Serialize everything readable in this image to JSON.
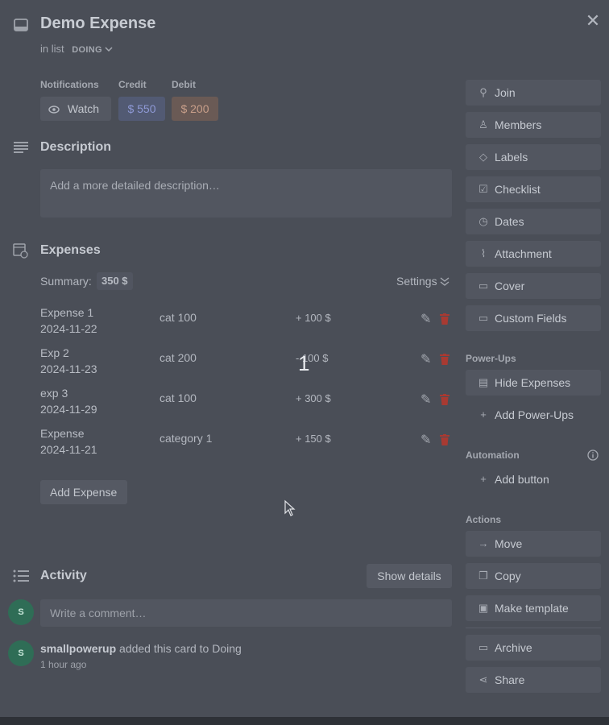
{
  "card": {
    "title": "Demo Expense",
    "in_list_prefix": "in list",
    "list_name": "DOING"
  },
  "labels": {
    "notifications": "Notifications",
    "credit": "Credit",
    "debit": "Debit"
  },
  "watch_label": "Watch",
  "credit_value": "$ 550",
  "debit_value": "$ 200",
  "description": {
    "heading": "Description",
    "placeholder": "Add a more detailed description…"
  },
  "expenses": {
    "heading": "Expenses",
    "summary_label": "Summary:",
    "summary_value": "350 $",
    "settings_label": "Settings",
    "items": [
      {
        "name": "Expense 1",
        "date": "2024-11-22",
        "category": "cat 100",
        "amount": "+ 100 $"
      },
      {
        "name": "Exp 2",
        "date": "2024-11-23",
        "category": "cat 200",
        "amount": "- 100 $"
      },
      {
        "name": "exp 3",
        "date": "2024-11-29",
        "category": "cat 100",
        "amount": "+ 300 $"
      },
      {
        "name": "Expense",
        "date": "2024-11-21",
        "category": "category 1",
        "amount": "+ 150 $"
      }
    ],
    "add_button": "Add Expense"
  },
  "activity": {
    "heading": "Activity",
    "show_details": "Show details",
    "comment_placeholder": "Write a comment…",
    "avatar_initial": "S",
    "entry_user": "smallpowerup",
    "entry_text": "added this card to Doing",
    "entry_time": "1 hour ago"
  },
  "sidebar": {
    "buttons": [
      {
        "label": "Join",
        "icon": "person-add-icon"
      },
      {
        "label": "Members",
        "icon": "person-icon"
      },
      {
        "label": "Labels",
        "icon": "label-icon"
      },
      {
        "label": "Checklist",
        "icon": "checklist-icon"
      },
      {
        "label": "Dates",
        "icon": "clock-icon"
      },
      {
        "label": "Attachment",
        "icon": "paperclip-icon"
      },
      {
        "label": "Cover",
        "icon": "cover-icon"
      },
      {
        "label": "Custom Fields",
        "icon": "custom-fields-icon"
      }
    ],
    "powerups_label": "Power-Ups",
    "hide_expenses": "Hide Expenses",
    "add_powerups": "Add Power-Ups",
    "automation_label": "Automation",
    "add_button": "Add button",
    "actions_label": "Actions",
    "actions": [
      {
        "label": "Move",
        "icon": "arrow-right-icon"
      },
      {
        "label": "Copy",
        "icon": "copy-icon"
      },
      {
        "label": "Make template",
        "icon": "template-icon"
      }
    ],
    "archive": "Archive",
    "share": "Share"
  },
  "overlay_number": "1"
}
